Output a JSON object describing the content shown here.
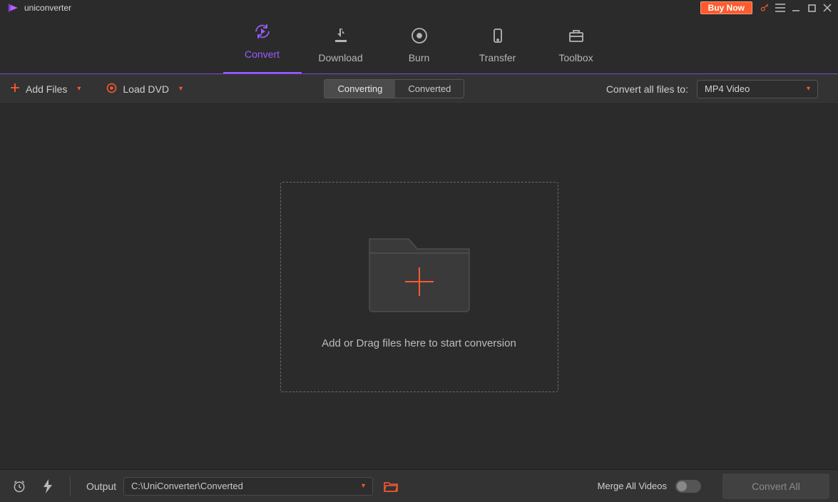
{
  "app": {
    "name": "uniconverter"
  },
  "titlebar": {
    "buy": "Buy Now"
  },
  "nav": {
    "convert": "Convert",
    "download": "Download",
    "burn": "Burn",
    "transfer": "Transfer",
    "toolbox": "Toolbox",
    "active": "convert"
  },
  "toolbar": {
    "add_files": "Add Files",
    "load_dvd": "Load DVD",
    "tab_converting": "Converting",
    "tab_converted": "Converted",
    "active_tab": "converting",
    "convert_all_label": "Convert all files to:",
    "target_format": "MP4 Video"
  },
  "drop": {
    "hint": "Add or Drag files here to start conversion"
  },
  "bottom": {
    "output_label": "Output",
    "output_path": "C:\\UniConverter\\Converted",
    "merge_label": "Merge All Videos",
    "merge_on": false,
    "convert_all": "Convert All"
  },
  "colors": {
    "accent": "#9a5cff",
    "orange": "#ff5a2e"
  }
}
